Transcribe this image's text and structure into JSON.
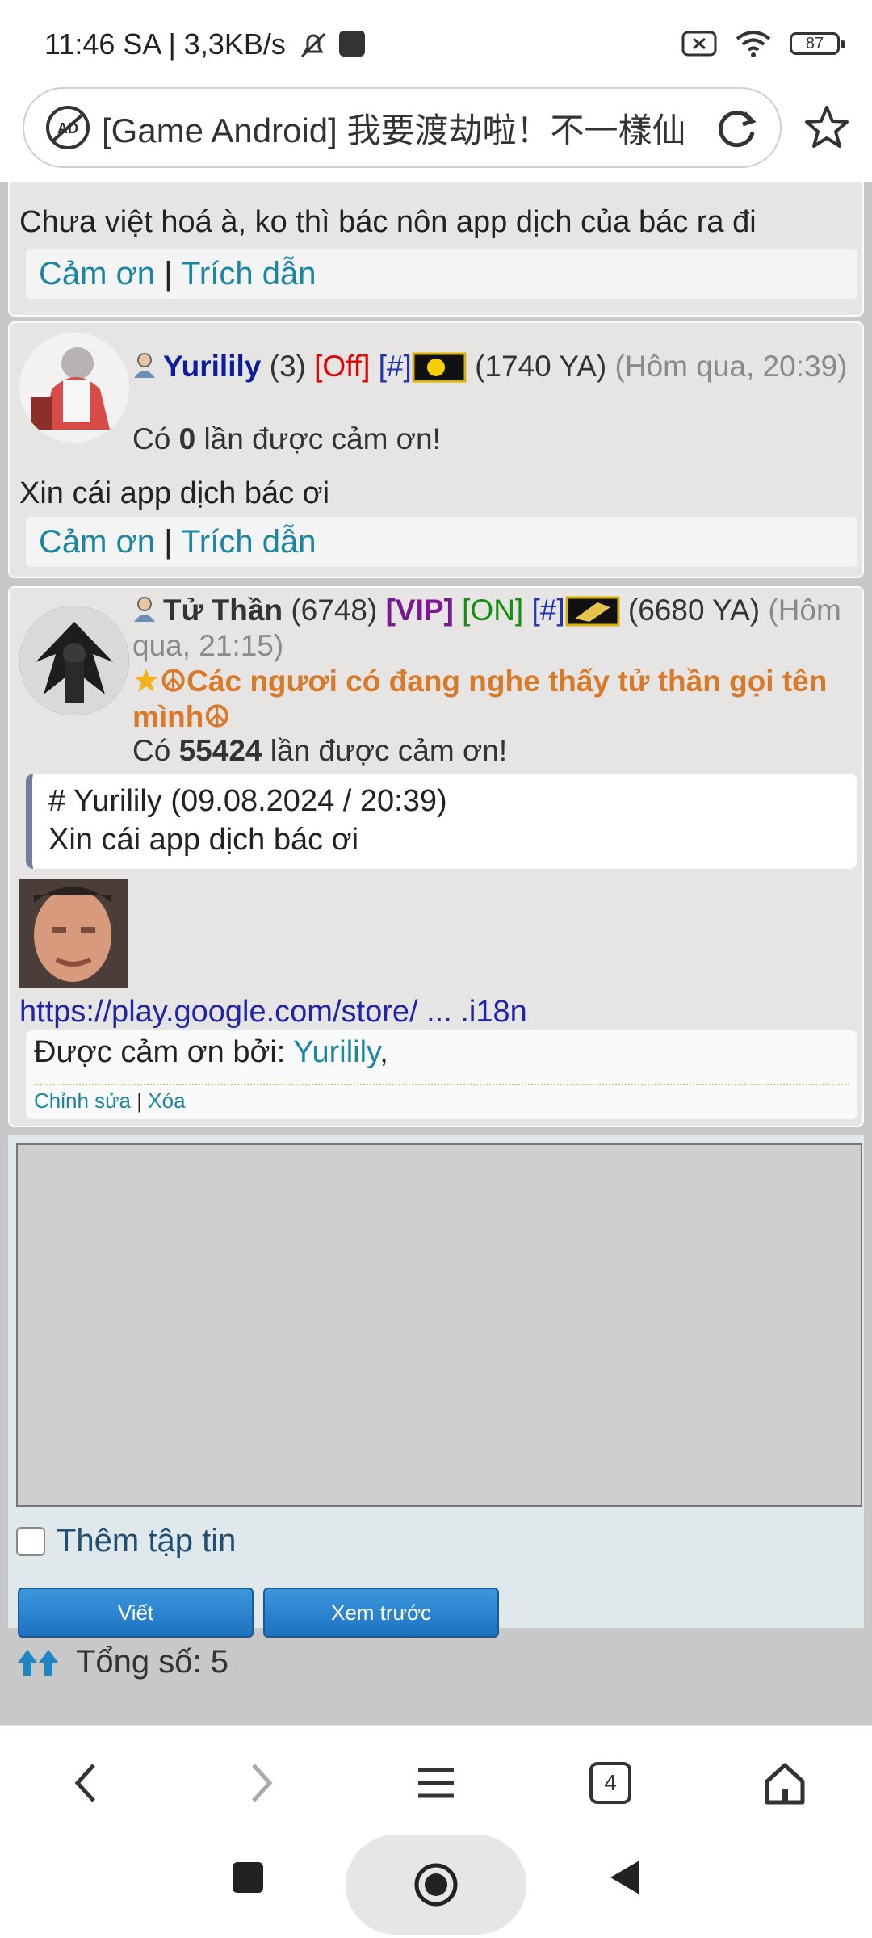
{
  "status_bar": {
    "time": "11:46 SA | 3,3KB/s",
    "battery": "87"
  },
  "browser": {
    "url_text": "[Game Android] 我要渡劫啦！不一樣仙",
    "tab_count": "4"
  },
  "posts": {
    "prev": {
      "message": "Chưa việt hoá à, ko thì bác nôn app dịch của bác ra đi",
      "thank": "Cảm ơn",
      "quote": "Trích dẫn",
      "sep": "|"
    },
    "yurilily": {
      "name": "Yurilily",
      "post_count": "(3)",
      "status": "[Off]",
      "hash": "[#]",
      "points": "(1740 YA)",
      "time": "(Hôm qua, 20:39)",
      "thanks_prefix": "Có",
      "thanks_count": "0",
      "thanks_suffix": "lần được cảm ơn!",
      "message": "Xin cái app dịch bác ơi",
      "thank": "Cảm ơn",
      "quote": "Trích dẫn",
      "sep": "|"
    },
    "tuthan": {
      "name": "Tử Thần",
      "post_count": "(6748)",
      "vip": "[VIP]",
      "status": "[ON]",
      "hash": "[#]",
      "points": "(6680 YA)",
      "time": "(Hôm qua, 21:15)",
      "title": "☮Các ngươi có đang nghe thấy tử thần gọi tên mình☮",
      "thanks_prefix": "Có",
      "thanks_count": "55424",
      "thanks_suffix": "lần được cảm ơn!",
      "quote_header": "# Yurilily (09.08.2024 / 20:39)",
      "quote_body": "Xin cái app dịch bác ơi",
      "link": "https://play.google.com/store/ ... .i18n",
      "thanked_by_label": "Được cảm ơn bởi:",
      "thanked_by_user": "Yurilily",
      "thanked_by_tail": ",",
      "edit": "Chỉnh sửa",
      "delete": "Xóa",
      "sep": "|"
    }
  },
  "reply": {
    "attach_label": "Thêm tập tin",
    "submit_label": "Viết",
    "preview_label": "Xem trước"
  },
  "footer": {
    "total": "Tổng số: 5"
  },
  "colors": {
    "link": "#1a86a2",
    "username": "#0b1c9c",
    "button": "#2a84d0"
  }
}
